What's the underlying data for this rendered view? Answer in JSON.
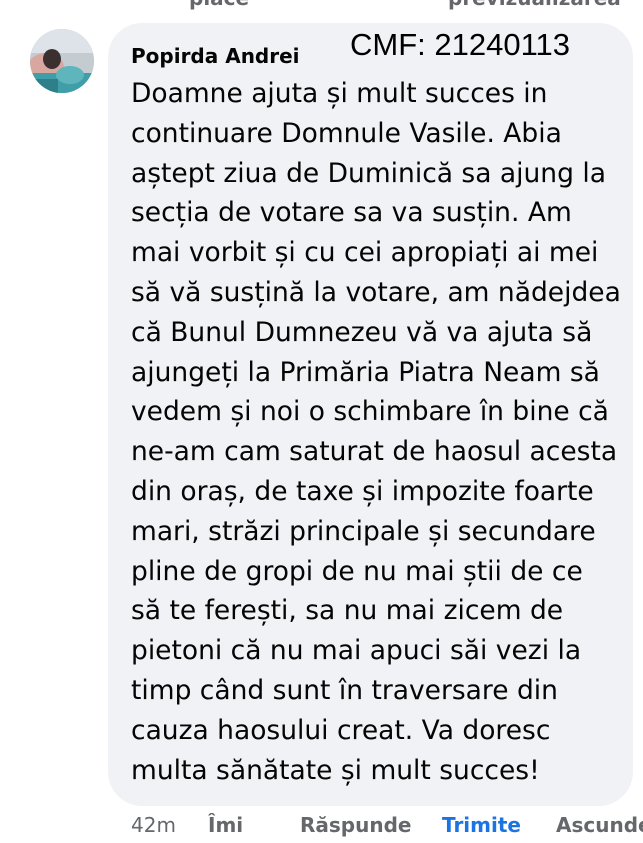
{
  "top_links": {
    "left": "place",
    "right": "previzualizarea"
  },
  "comment": {
    "author": "Popirda Andrei",
    "stamp": "CMF: 21240113",
    "lines": [
      "Doamne ajuta și mult succes in",
      "continuare Domnule Vasile. Abia",
      "aștept ziua de Duminică sa ajung la",
      "secția de votare sa va susțin. Am",
      "mai vorbit și cu cei apropiați ai mei",
      "să vă susțină la votare, am nădejdea",
      "că Bunul Dumnezeu vă va ajuta să",
      "ajungeți la Primăria Piatra Neam să",
      "vedem și noi o schimbare în bine că",
      "ne-am cam saturat de haosul acesta",
      "din oraș, de taxe și impozite foarte",
      "mari, străzi principale și secundare",
      "pline de gropi de nu mai știi de ce",
      "să te ferești, sa nu mai zicem de",
      "pietoni că nu mai apuci săi vezi la",
      "timp când sunt în traversare din",
      "cauza haosului creat. Va doresc",
      "multa sănătate și mult succes!"
    ]
  },
  "actions": {
    "time": "42m",
    "like": "Îmi",
    "reply": "Răspunde",
    "send": "Trimite",
    "hide": "Ascunde"
  },
  "colors": {
    "bubble": "#f0f2f5",
    "link_blue": "#1b74e4",
    "muted": "#65676b"
  }
}
